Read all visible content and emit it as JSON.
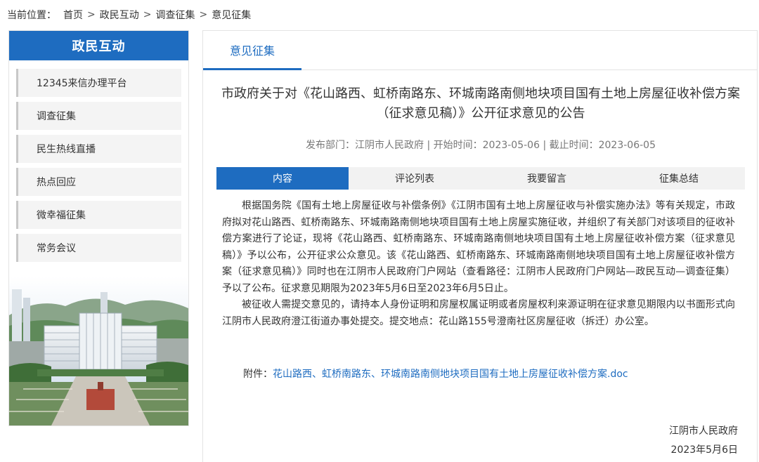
{
  "breadcrumb": {
    "prefix": "当前位置：",
    "items": [
      "首页",
      "政民互动",
      "调查征集",
      "意见征集"
    ],
    "separator": ">"
  },
  "sidebar": {
    "title": "政民互动",
    "items": [
      {
        "label": "12345来信办理平台"
      },
      {
        "label": "调查征集"
      },
      {
        "label": "民生热线直播"
      },
      {
        "label": "热点回应"
      },
      {
        "label": "微幸福征集"
      },
      {
        "label": "常务会议"
      }
    ]
  },
  "main": {
    "tab_label": "意见征集",
    "article": {
      "title": "市政府关于对《花山路西、虹桥南路东、环城南路南侧地块项目国有土地上房屋征收补偿方案（征求意见稿）》公开征求意见的公告",
      "meta": "发布部门：江阴市人民政府 | 开始时间：2023-05-06 | 截止时间：2023-06-05",
      "content_tabs": [
        "内容",
        "评论列表",
        "我要留言",
        "征集总结"
      ],
      "active_tab": "内容",
      "paragraphs": [
        "根据国务院《国有土地上房屋征收与补偿条例》《江阴市国有土地上房屋征收与补偿实施办法》等有关规定，市政府拟对花山路西、虹桥南路东、环城南路南侧地块项目国有土地上房屋实施征收，并组织了有关部门对该项目的征收补偿方案进行了论证，现将《花山路西、虹桥南路东、环城南路南侧地块项目国有土地上房屋征收补偿方案（征求意见稿）》予以公布，公开征求公众意见。该《花山路西、虹桥南路东、环城南路南侧地块项目国有土地上房屋征收补偿方案（征求意见稿）》同时也在江阴市人民政府门户网站（查看路径：江阴市人民政府门户网站—政民互动—调查征集）予以了公布。征求意见期限为2023年5月6日至2023年6月5日止。",
        "被征收人需提交意见的，请持本人身份证明和房屋权属证明或者房屋权利来源证明在征求意见期限内以书面形式向江阴市人民政府澄江街道办事处提交。提交地点：花山路155号澄南社区房屋征收（拆迁）办公室。"
      ],
      "attachment_label": "附件：",
      "attachment_link": "花山路西、虹桥南路东、环城南路南侧地块项目国有土地上房屋征收补偿方案.doc",
      "signature_org": "江阴市人民政府",
      "signature_date": "2023年5月6日"
    }
  },
  "colors": {
    "accent": "#1e6cc0",
    "tab_bg": "#f2f2f2",
    "side_item_bg": "#f4f4f4"
  }
}
